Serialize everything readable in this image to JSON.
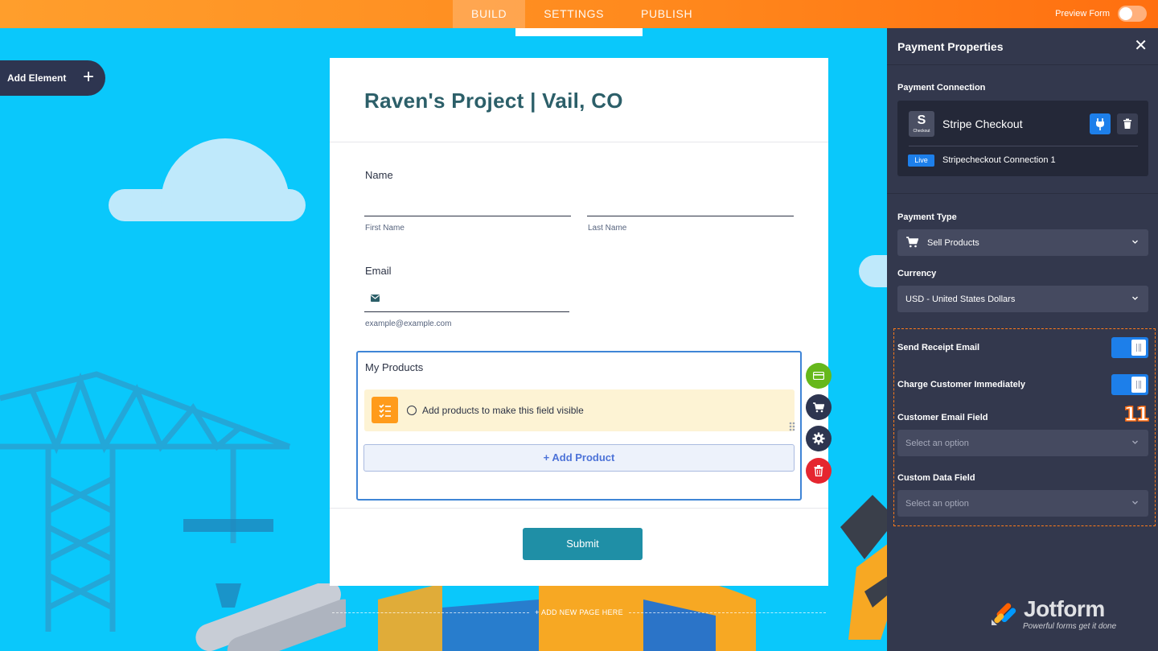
{
  "topbar": {
    "tabs": [
      {
        "label": "BUILD",
        "active": true
      },
      {
        "label": "SETTINGS",
        "active": false
      },
      {
        "label": "PUBLISH",
        "active": false
      }
    ],
    "preview_label": "Preview Form"
  },
  "canvas": {
    "add_element_label": "Add Element",
    "add_page_label": "+ ADD NEW PAGE HERE"
  },
  "form": {
    "title": "Raven's Project | Vail, CO",
    "name_label": "Name",
    "first_name_sublabel": "First Name",
    "last_name_sublabel": "Last Name",
    "email_label": "Email",
    "email_sublabel": "example@example.com",
    "products_title": "My Products",
    "products_notice": "Add products to make this field visible",
    "add_product_label": "+ Add Product",
    "submit_label": "Submit"
  },
  "panel": {
    "title": "Payment Properties",
    "connection_label": "Payment Connection",
    "connection_name": "Stripe Checkout",
    "connection_logo_letter": "S",
    "connection_logo_caption": "Checkout",
    "live_badge": "Live",
    "connection_sub": "Stripecheckout Connection 1",
    "payment_type_label": "Payment Type",
    "payment_type_value": "Sell Products",
    "currency_label": "Currency",
    "currency_value": "USD - United States Dollars",
    "send_receipt_label": "Send Receipt Email",
    "send_receipt_on": true,
    "charge_immediately_label": "Charge Customer Immediately",
    "charge_immediately_on": true,
    "customer_email_label": "Customer Email Field",
    "customer_email_placeholder": "Select an option",
    "custom_data_label": "Custom Data Field",
    "custom_data_placeholder": "Select an option",
    "step_badge": "11",
    "brand_name": "Jotform",
    "brand_tagline": "Powerful forms get it done"
  },
  "colors": {
    "accent": "#1d7fea",
    "topbar": "#ff8a1e",
    "panel_bg": "#33384d",
    "form_title": "#2c5f69",
    "submit": "#1f8fa6",
    "highlight": "#ff7b1a"
  }
}
